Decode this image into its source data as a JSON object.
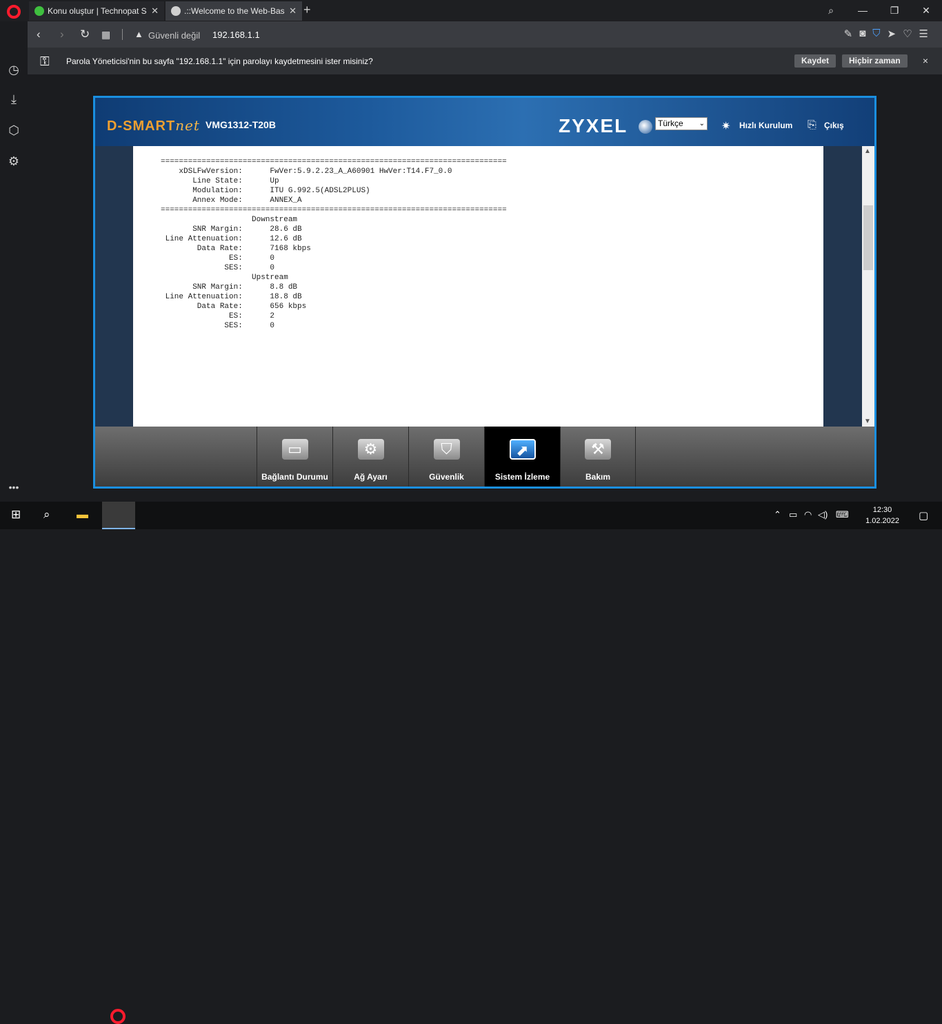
{
  "browser": {
    "tabs": [
      {
        "title": "Konu oluştur | Technopat S",
        "active": false
      },
      {
        "title": ".::Welcome to the Web-Bas",
        "active": true
      }
    ],
    "new_tab": "+",
    "window_controls": {
      "search": "⌕",
      "minimize": "—",
      "restore": "❐",
      "close": "✕"
    },
    "address": {
      "insecure_label": "Güvenli değil",
      "url": "192.168.1.1"
    },
    "password_bar": {
      "message": "Parola Yöneticisi'nin bu sayfa \"192.168.1.1\" için parolayı kaydetmesini ister misiniz?",
      "save_label": "Kaydet",
      "never_label": "Hiçbir zaman",
      "close": "×"
    }
  },
  "router": {
    "brand": "D-SMART",
    "brand_suffix": "net",
    "model": "VMG1312-T20B",
    "vendor": "ZYXEL",
    "language": "Türkçe",
    "quick_setup": "Hızlı Kurulum",
    "logout": "Çıkış",
    "status_text": "Status :\n\n============================================================================\n    xDSLFwVersion:      FwVer:5.9.2.23_A_A60901 HwVer:T14.F7_0.0\n       Line State:      Up\n       Modulation:      ITU G.992.5(ADSL2PLUS)\n       Annex Mode:      ANNEX_A\n============================================================================\n                    Downstream\n       SNR Margin:      28.6 dB\n Line Attenuation:      12.6 dB\n        Data Rate:      7168 kbps\n               ES:      0\n              SES:      0\n                    Upstream\n       SNR Margin:      8.8 dB\n Line Attenuation:      18.8 dB\n        Data Rate:      656 kbps\n               ES:      2\n              SES:      0",
    "nav": [
      {
        "label": "Bağlantı Durumu",
        "active": false
      },
      {
        "label": "Ağ Ayarı",
        "active": false
      },
      {
        "label": "Güvenlik",
        "active": false
      },
      {
        "label": "Sistem İzleme",
        "active": true
      },
      {
        "label": "Bakım",
        "active": false
      }
    ]
  },
  "taskbar": {
    "time": "12:30",
    "date": "1.02.2022"
  },
  "colors": {
    "router_border": "#1a8fe0",
    "opera_red": "#ff1b2d",
    "brand_orange": "#f0a030"
  }
}
